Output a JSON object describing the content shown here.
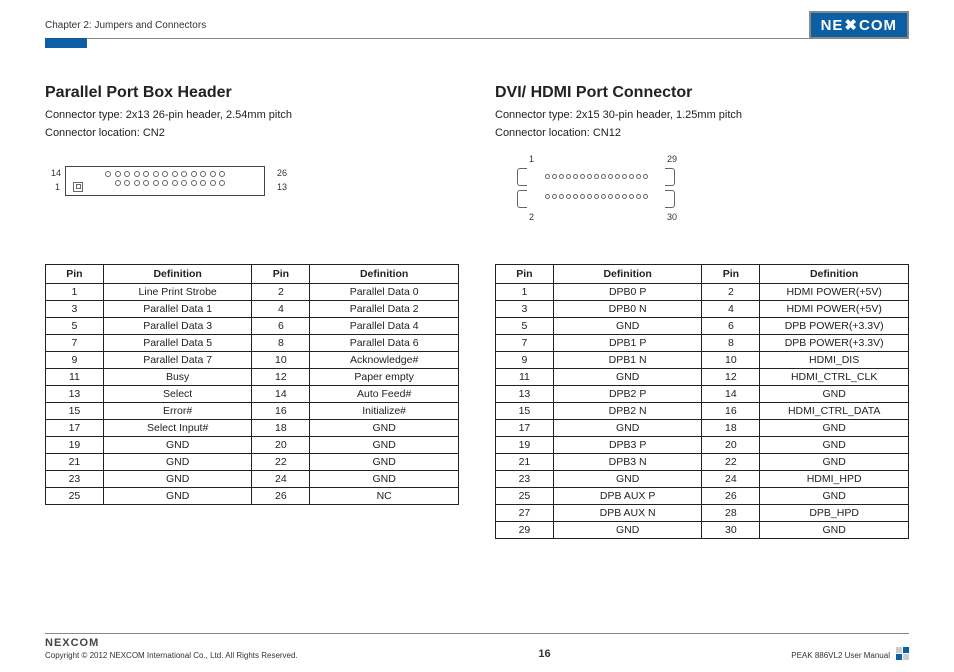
{
  "header": {
    "chapter": "Chapter 2: Jumpers and Connectors",
    "logo_text": "NE COM",
    "logo_x": "X"
  },
  "left": {
    "title": "Parallel Port Box Header",
    "conn_type": "Connector type: 2x13 26-pin header, 2.54mm pitch",
    "conn_loc": "Connector location: CN2",
    "diag": {
      "n14": "14",
      "n1": "1",
      "n26": "26",
      "n13": "13"
    },
    "cols": {
      "pin": "Pin",
      "def": "Definition"
    },
    "rows": [
      {
        "p1": "1",
        "d1": "Line Print Strobe",
        "p2": "2",
        "d2": "Parallel Data 0"
      },
      {
        "p1": "3",
        "d1": "Parallel Data 1",
        "p2": "4",
        "d2": "Parallel Data 2"
      },
      {
        "p1": "5",
        "d1": "Parallel Data 3",
        "p2": "6",
        "d2": "Parallel Data 4"
      },
      {
        "p1": "7",
        "d1": "Parallel Data 5",
        "p2": "8",
        "d2": "Parallel Data 6"
      },
      {
        "p1": "9",
        "d1": "Parallel Data 7",
        "p2": "10",
        "d2": "Acknowledge#"
      },
      {
        "p1": "11",
        "d1": "Busy",
        "p2": "12",
        "d2": "Paper empty"
      },
      {
        "p1": "13",
        "d1": "Select",
        "p2": "14",
        "d2": "Auto Feed#"
      },
      {
        "p1": "15",
        "d1": "Error#",
        "p2": "16",
        "d2": "Initialize#"
      },
      {
        "p1": "17",
        "d1": "Select Input#",
        "p2": "18",
        "d2": "GND"
      },
      {
        "p1": "19",
        "d1": "GND",
        "p2": "20",
        "d2": "GND"
      },
      {
        "p1": "21",
        "d1": "GND",
        "p2": "22",
        "d2": "GND"
      },
      {
        "p1": "23",
        "d1": "GND",
        "p2": "24",
        "d2": "GND"
      },
      {
        "p1": "25",
        "d1": "GND",
        "p2": "26",
        "d2": "NC"
      }
    ]
  },
  "right": {
    "title": "DVI/ HDMI Port Connector",
    "conn_type": "Connector type: 2x15 30-pin header, 1.25mm pitch",
    "conn_loc": "Connector location: CN12",
    "diag": {
      "n1": "1",
      "n29": "29",
      "n2": "2",
      "n30": "30"
    },
    "cols": {
      "pin": "Pin",
      "def": "Definition"
    },
    "rows": [
      {
        "p1": "1",
        "d1": "DPB0 P",
        "p2": "2",
        "d2": "HDMI POWER(+5V)"
      },
      {
        "p1": "3",
        "d1": "DPB0 N",
        "p2": "4",
        "d2": "HDMI POWER(+5V)"
      },
      {
        "p1": "5",
        "d1": "GND",
        "p2": "6",
        "d2": "DPB POWER(+3.3V)"
      },
      {
        "p1": "7",
        "d1": "DPB1 P",
        "p2": "8",
        "d2": "DPB POWER(+3.3V)"
      },
      {
        "p1": "9",
        "d1": "DPB1 N",
        "p2": "10",
        "d2": "HDMI_DIS"
      },
      {
        "p1": "11",
        "d1": "GND",
        "p2": "12",
        "d2": "HDMI_CTRL_CLK"
      },
      {
        "p1": "13",
        "d1": "DPB2 P",
        "p2": "14",
        "d2": "GND"
      },
      {
        "p1": "15",
        "d1": "DPB2 N",
        "p2": "16",
        "d2": "HDMI_CTRL_DATA"
      },
      {
        "p1": "17",
        "d1": "GND",
        "p2": "18",
        "d2": "GND"
      },
      {
        "p1": "19",
        "d1": "DPB3 P",
        "p2": "20",
        "d2": "GND"
      },
      {
        "p1": "21",
        "d1": "DPB3 N",
        "p2": "22",
        "d2": "GND"
      },
      {
        "p1": "23",
        "d1": "GND",
        "p2": "24",
        "d2": "HDMI_HPD"
      },
      {
        "p1": "25",
        "d1": "DPB AUX P",
        "p2": "26",
        "d2": "GND"
      },
      {
        "p1": "27",
        "d1": "DPB AUX N",
        "p2": "28",
        "d2": "DPB_HPD"
      },
      {
        "p1": "29",
        "d1": "GND",
        "p2": "30",
        "d2": "GND"
      }
    ]
  },
  "footer": {
    "brand": "NEXCOM",
    "copyright": "Copyright © 2012 NEXCOM International Co., Ltd. All Rights Reserved.",
    "page": "16",
    "doc": "PEAK 886VL2 User Manual"
  }
}
